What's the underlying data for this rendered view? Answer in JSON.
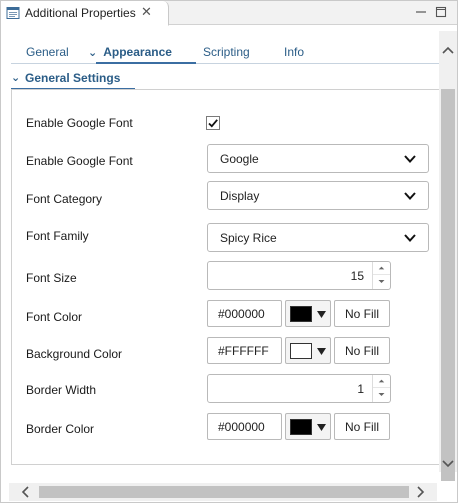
{
  "view": {
    "title": "Additional Properties",
    "close_glyph": "✕"
  },
  "tabs": [
    {
      "label": "General"
    },
    {
      "label": "Appearance"
    },
    {
      "label": "Scripting"
    },
    {
      "label": "Info"
    }
  ],
  "section": {
    "title": "General Settings"
  },
  "rows": {
    "enable_google_font_checkbox": {
      "label": "Enable Google Font",
      "checked": true
    },
    "enable_google_font_combo": {
      "label": "Enable Google Font",
      "value": "Google"
    },
    "font_category": {
      "label": "Font Category",
      "value": "Display"
    },
    "font_family": {
      "label": "Font Family",
      "value": "Spicy Rice"
    },
    "font_size": {
      "label": "Font Size",
      "value": "15"
    },
    "font_color": {
      "label": "Font Color",
      "value": "#000000",
      "swatch": "#000000",
      "nofill": "No Fill"
    },
    "background_color": {
      "label": "Background Color",
      "value": "#FFFFFF",
      "swatch": "#FFFFFF",
      "nofill": "No Fill"
    },
    "border_width": {
      "label": "Border Width",
      "value": "1"
    },
    "border_color": {
      "label": "Border Color",
      "value": "#000000",
      "swatch": "#000000",
      "nofill": "No Fill"
    }
  },
  "colors": {
    "accent": "#2b5d87",
    "underline": "#3b6ea2"
  }
}
